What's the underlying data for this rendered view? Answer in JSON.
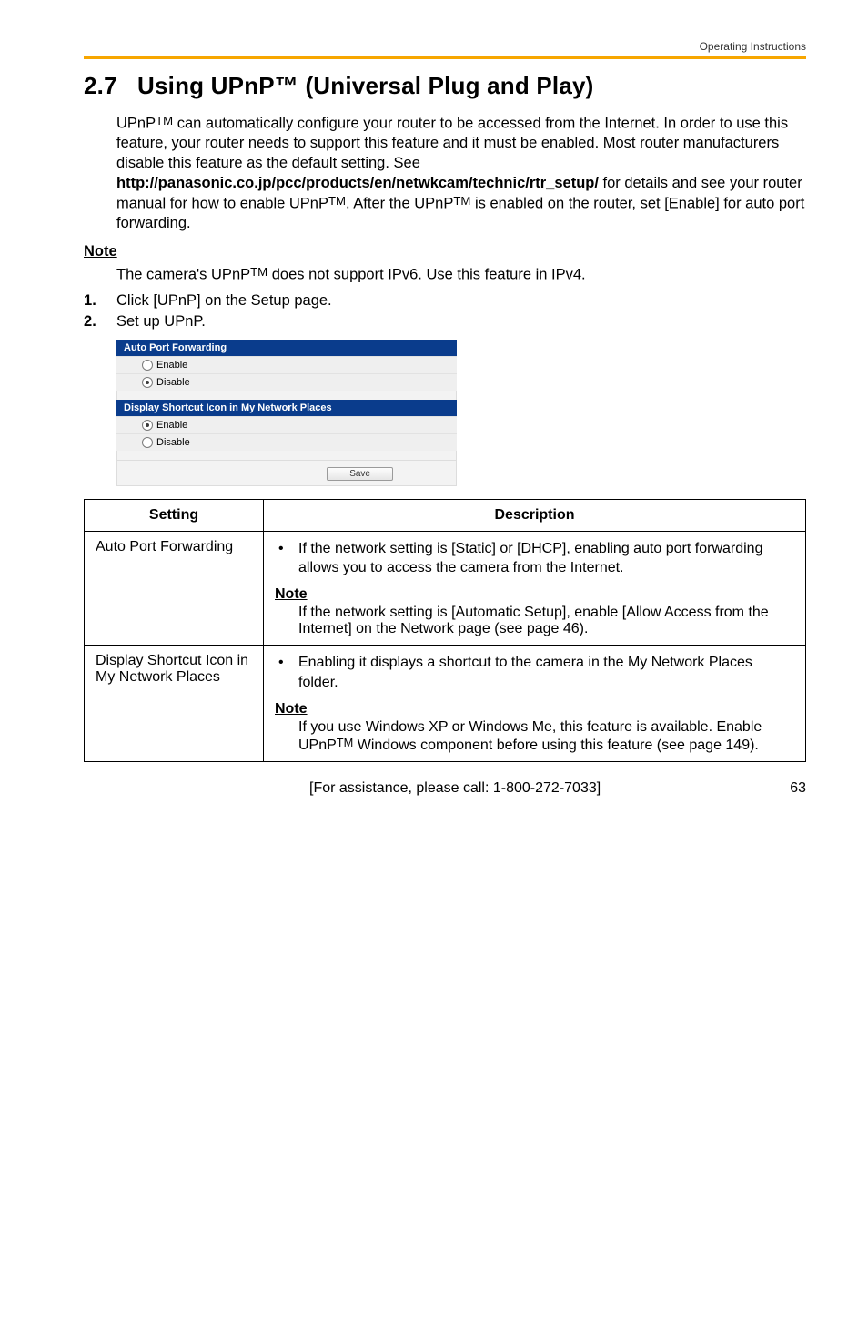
{
  "running_head": "Operating Instructions",
  "section": {
    "number": "2.7",
    "title": "Using UPnP™ (Universal Plug and Play)"
  },
  "intro": {
    "part1": "UPnP",
    "tm1": "TM",
    "part2": " can automatically configure your router to be accessed from the Internet. In order to use this feature, your router needs to support this feature and it must be enabled. Most router manufacturers disable this feature as the default setting. See ",
    "link": "http://panasonic.co.jp/pcc/products/en/netwkcam/technic/rtr_setup/",
    "part3": " for details and see your router manual for how to enable UPnP",
    "tm2": "TM",
    "part4": ". After the UPnP",
    "tm3": "TM",
    "part5": " is enabled on the router, set [Enable] for auto port forwarding."
  },
  "note": {
    "label": "Note",
    "text_a": "The camera's UPnP",
    "tm": "TM",
    "text_b": " does not support IPv6. Use this feature in IPv4."
  },
  "steps": [
    "Click [UPnP] on the Setup page.",
    "Set up UPnP."
  ],
  "shot": {
    "group1": {
      "header": "Auto Port Forwarding",
      "opt_enable": "Enable",
      "opt_disable": "Disable",
      "selected": "Disable"
    },
    "group2": {
      "header": "Display Shortcut Icon in My Network Places",
      "opt_enable": "Enable",
      "opt_disable": "Disable",
      "selected": "Enable"
    },
    "save": "Save"
  },
  "table": {
    "head_setting": "Setting",
    "head_description": "Description",
    "rows": [
      {
        "setting": "Auto Port Forwarding",
        "bullet": "If the network setting is [Static] or [DHCP], enabling auto port forwarding allows you to access the camera from the Internet.",
        "note_label": "Note",
        "note_text": "If the network setting is [Automatic Setup], enable [Allow Access from the Internet] on the Network page (see page 46)."
      },
      {
        "setting": "Display Shortcut Icon in My Network Places",
        "bullet": "Enabling it displays a shortcut to the camera in the My Network Places folder.",
        "note_label": "Note",
        "note_text_a": "If you use Windows XP or Windows Me, this feature is available. Enable UPnP",
        "tm": "TM",
        "note_text_b": " Windows component before using this feature (see page 149)."
      }
    ]
  },
  "footer": {
    "assist": "[For assistance, please call: 1-800-272-7033]",
    "page": "63"
  }
}
